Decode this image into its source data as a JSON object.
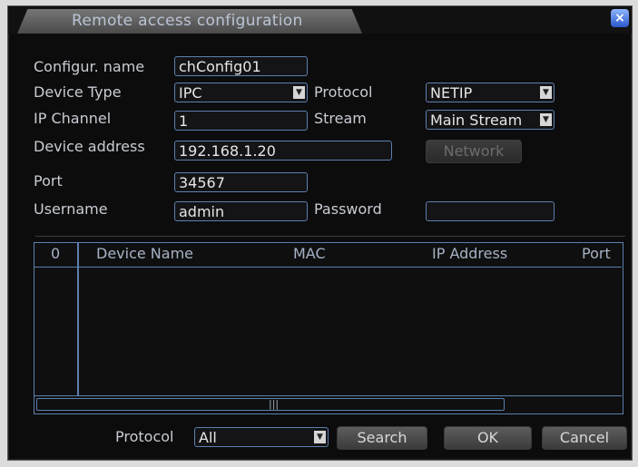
{
  "window": {
    "title": "Remote access configuration",
    "close": "×"
  },
  "form": {
    "config_name_label": "Configur. name",
    "config_name_value": "chConfig01",
    "device_type_label": "Device Type",
    "device_type_value": "IPC",
    "protocol_label": "Protocol",
    "protocol_value": "NETIP",
    "ip_channel_label": "IP Channel",
    "ip_channel_value": "1",
    "stream_label": "Stream",
    "stream_value": "Main Stream",
    "device_address_label": "Device address",
    "device_address_value": "192.168.1.20",
    "network_button": "Network",
    "port_label": "Port",
    "port_value": "34567",
    "username_label": "Username",
    "username_value": "admin",
    "password_label": "Password",
    "password_value": ""
  },
  "table": {
    "columns": [
      "0",
      "Device Name",
      "MAC",
      "IP Address",
      "Port"
    ],
    "rows": [],
    "scroll_grip": "|||"
  },
  "footer": {
    "protocol_label": "Protocol",
    "protocol_value": "All",
    "search_button": "Search",
    "ok_button": "OK",
    "cancel_button": "Cancel"
  },
  "icons": {
    "dropdown": "chevron-down-icon",
    "close": "close-icon"
  },
  "colors": {
    "background": "#0c0c0d",
    "field_border": "#5d7fae",
    "label": "#c8ccd2"
  }
}
